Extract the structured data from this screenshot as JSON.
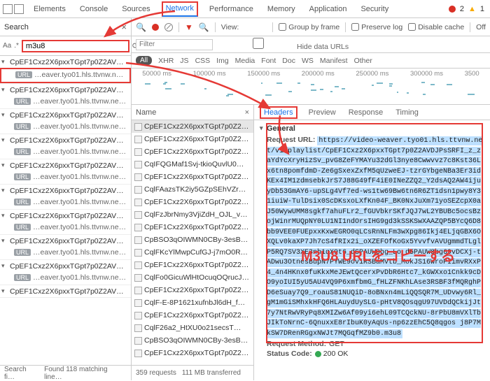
{
  "topbar": {
    "tabs": [
      "Elements",
      "Console",
      "Sources",
      "Network",
      "Performance",
      "Memory",
      "Application",
      "Security"
    ],
    "active": 3,
    "errors": "2",
    "warnings": "1"
  },
  "search": {
    "title": "Search",
    "aa": "Aa",
    "star": ".*",
    "query": "m3u8",
    "footer_a": "Search fi…",
    "footer_b": "Found 118 matching line…",
    "groups": [
      {
        "title": "CpEF1Cxz2X6pxxTGpt7p0Z2AVDJP…",
        "url": "…eaver.tyo01.hls.ttvnw.net/v…",
        "hl": true
      },
      {
        "title": "CpEF1Cxz2X6pxxTGpt7p0Z2AVDJP…",
        "url": "…eaver.tyo01.hls.ttvnw.net/v…"
      },
      {
        "title": "CpEF1Cxz2X6pxxTGpt7p0Z2AVDJP…",
        "url": "…eaver.tyo01.hls.ttvnw.net/v…"
      },
      {
        "title": "CpEF1Cxz2X6pxxTGpt7p0Z2AVDJP…",
        "url": "…eaver.tyo01.hls.ttvnw.net/v…"
      },
      {
        "title": "CpEF1Cxz2X6pxxTGpt7p0Z2AVDJP…",
        "url": "…eaver.tyo01.hls.ttvnw.net/v…"
      },
      {
        "title": "CpEF1Cxz2X6pxxTGpt7p0Z2AVDJP…",
        "url": "…eaver.tyo01.hls.ttvnw.net/v…"
      },
      {
        "title": "CpEF1Cxz2X6pxxTGpt7p0Z2AVDJP…",
        "url": "…eaver.tyo01.hls.ttvnw.net/v…"
      },
      {
        "title": "CpEF1Cxz2X6pxxTGpt7p0Z2AVDJP…",
        "url": "…eaver.tyo01.hls.ttvnw.net/v…"
      },
      {
        "title": "CpEF1Cxz2X6pxxTGpt7p0Z2AVDJP…",
        "url": "…eaver.tyo01.hls.ttvnw.net/v…"
      },
      {
        "title": "CpEF1Cxz2X6pxxTGpt7p0Z2AVDJP…",
        "url": ""
      }
    ]
  },
  "toolbar": {
    "view": "View:",
    "group": "Group by frame",
    "preserve": "Preserve log",
    "disable": "Disable cache",
    "off": "Off"
  },
  "filterrow": {
    "placeholder": "Filter",
    "hide": "Hide data URLs"
  },
  "types": [
    "All",
    "XHR",
    "JS",
    "CSS",
    "Img",
    "Media",
    "Font",
    "Doc",
    "WS",
    "Manifest",
    "Other"
  ],
  "timeline": [
    "50000 ms",
    "100000 ms",
    "150000 ms",
    "200000 ms",
    "250000 ms",
    "300000 ms",
    "3500"
  ],
  "names": {
    "header": "Name",
    "items": [
      "CpEF1Cxz2X6pxxTGpt7p0Z2…",
      "CpEF1Cxz2X6pxxTGpt7p0Z2…",
      "CpEF1Cxz2X6pxxTGpt7p0Z2…",
      "CqIFQGMaf1Svj-tkioQuvlU0…",
      "CpEF1Cxz2X6pxxTGpt7p0Z2…",
      "CqlFAazsTK2iy5GZpSEhVZrc…",
      "CpEF1Cxz2X6pxxTGpt7p0Z2…",
      "CqlFzJbrNmy3VjiZdH_OJL_v…",
      "CpEF1Cxz2X6pxxTGpt7p0Z2…",
      "CpBSO3qOIWMN0CBy-3esBf9…",
      "CqlFKcYlMwpCufGJ-j7mO0RYS…",
      "CpEF1Cxz2X6pxxTGpt7p0Z2…",
      "CqlFo0GicuWlHtOcuqOQrucJ…",
      "CpEF1Cxz2X6pxxTGpt7p0Z2…",
      "CqlF-E-8P1621xufnbJl6dH_f…",
      "CpEF1Cxz2X6pxxTGpt7p0Z2…",
      "CqlF26a2_HtXU0o21secsT…",
      "CpBSO3qOIWMN0CBy-3esBf9…",
      "CpEF1Cxz2X6pxxTGpt7p0Z2…"
    ],
    "footer_a": "359 requests",
    "footer_b": "111 MB transferred"
  },
  "detail": {
    "tabs": [
      "Headers",
      "Preview",
      "Response",
      "Timing"
    ],
    "active": 0,
    "general": "General",
    "req_url_k": "Request URL:",
    "req_url_v": "https://video-weaver.tyo01.hls.ttvnw.net/v1/playlist/CpEF1Cxz2X6pxxTGpt7p0Z2AVDJPsSRFI_z_zaYdYcXryHizSv_pvG8ZeFYMAYu32dGl3nye8Cwwvvz7c8Kst36Lx6tn8pomfdmD-Ze6gSxexZxfM5qUzweEJ-tzrGYbgeNBa3Er3idKEx4IM1zdmsebkJrS7J88G49fF4iE0INeZZQ2_Y2dsAQ2AW4ijuyDb53GmAY6-upSLg4Vf7ed-ws1tw69Bw6tn6R6ZT1dsn1pwy8Y31iuiW-TulDsix0ScDKsxoLXfKn04F_BK0NxJuXm71yoSEZcpX0aJ50WywUMM8sgkf7ahuFLr2_fGUVbkrSKfJQJ7wL2YBUBc5ocsBzojWinrMUQpNY0LU1NI1ndOrsIHG9gd3kSSKSwXAAZQP5BYcQ6D8bb9VEE0FUEpxxKxwEGRO0qLCsRnNLFm3wXpg86Ikj4ELjqGBX6OXQLv0kaXP7Jh7cS4fRIx2i_oXZEFOfKoGx5YvvfvAVUgmmdTLglP5RQ7SV3XE3nh1qX9t6_dSPAUW8bg_Lo_d5PAUW8bg69vDCXj-tADwu3OtnesBupN7PYWE9ov1RSBaMVtb_MokJS16WroFIimvRXxP4_4n4HKnx0fuKkxMeJEwtQcerxPvDbR6Htc7_kGWXxo1Cnkk9cDO9yoIUI5yU5AU4VQ9P6xmfbmG_fHLZFNKhLAse3RSBF3fMQRghPD6eSuay7Q9_roauS81NUQiD-8oBNxn4mLiQQSQR7M_UDvwy6Rl_gM1mGiSMhxkHFQ6HLAuydUySLG-pHtV8QOsqgU97UVDdQCkijJt7y7NtRwVRyPq8XMIZw6Af09yi6ehL09TCQckNU-8rPbU8mVXlTbJIkToNrnC-6QnuxxE8rIbuK0yAqUs-np6zzEhC5Q8qgos j8P7MkSW7DRenRGgxNWJt7MQGqfMZ9b0.m3u8",
    "req_method_k": "Request Method:",
    "req_method_v": "GET",
    "status_k": "Status Code:",
    "status_v": "200  OK"
  },
  "annotation": "M3U8 URLをコピーする"
}
